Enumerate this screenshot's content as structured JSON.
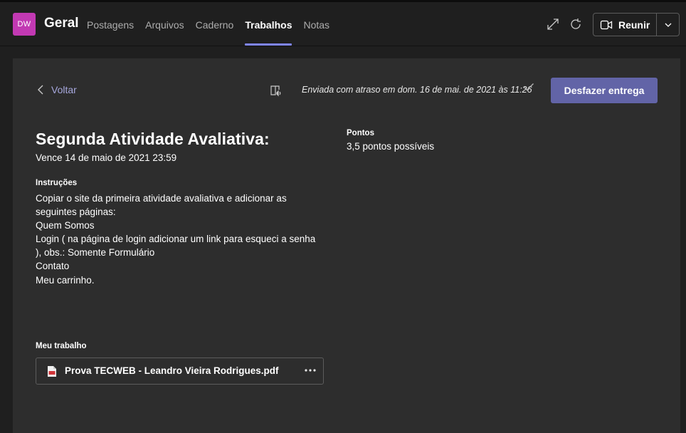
{
  "header": {
    "avatar_initials": "DW",
    "team_name": "Geral",
    "tabs": [
      {
        "label": "Postagens"
      },
      {
        "label": "Arquivos"
      },
      {
        "label": "Caderno"
      },
      {
        "label": "Trabalhos"
      },
      {
        "label": "Notas"
      }
    ],
    "active_tab": "Trabalhos",
    "meet_button_label": "Reunir",
    "icons": [
      "expand-icon",
      "refresh-icon",
      "video-camera-icon",
      "chevron-down-icon"
    ]
  },
  "assignment": {
    "back_label": "Voltar",
    "status_text": "Enviada com atraso em dom. 16 de mai. de 2021 às 11:26",
    "undo_button_label": "Desfazer entrega",
    "title": "Segunda Atividade Avaliativa:",
    "due_text": "Vence 14 de maio de 2021 23:59",
    "points_label": "Pontos",
    "points_value": "3,5 pontos possíveis",
    "instructions_label": "Instruções",
    "instructions_lines": [
      "Copiar o site da primeira atividade avaliativa e adicionar as",
      "seguintes páginas:",
      "Quem Somos",
      "Login ( na página de login adicionar um link para esqueci a senha",
      "), obs.: Somente Formulário",
      "Contato",
      "Meu carrinho."
    ],
    "my_work_label": "Meu trabalho",
    "attachment": {
      "file_name": "Prova TECWEB - Leandro Vieira Rodrigues.pdf"
    }
  },
  "colors": {
    "accent": "#6264a7",
    "tab_underline": "#7f85f5",
    "back_link": "#a6a7dc",
    "avatar": "#c239b3",
    "panel": "#2d2d2d",
    "background": "#1f1f1f"
  }
}
